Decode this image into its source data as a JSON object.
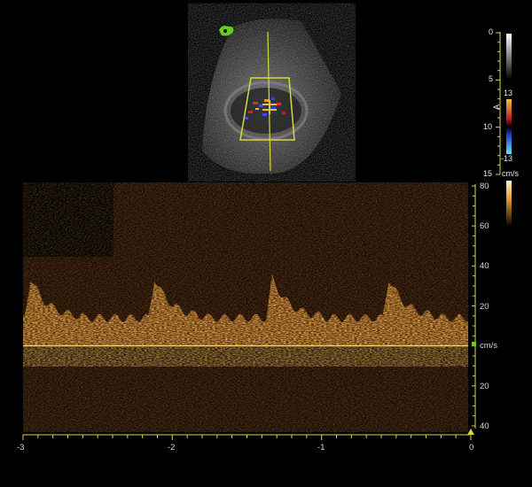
{
  "depth_scale": {
    "ticks": [
      "0",
      "5",
      "10",
      "15"
    ]
  },
  "color_scale": {
    "top": "13",
    "bottom": "-13",
    "mode": "A"
  },
  "spectral_scale": {
    "unit": "cm/s"
  },
  "velocity_axis": {
    "ticks": [
      "80",
      "60",
      "40",
      "20",
      "20",
      "40"
    ],
    "unit": "cm/s",
    "range": [
      -40,
      80
    ]
  },
  "time_axis": {
    "ticks": [
      "-3",
      "-2",
      "-1",
      "0"
    ],
    "range": [
      -3,
      0
    ]
  },
  "colors": {
    "axis": "#d6d64a",
    "baseline": "#f0d27a",
    "spectral": "#e8992a",
    "colorbox": "#d8d83a",
    "logo": "#66cc22"
  },
  "icons": {
    "logo": "probe-orientation-icon",
    "marker": "baseline-marker-icon",
    "time_marker": "triangle-up-icon"
  }
}
